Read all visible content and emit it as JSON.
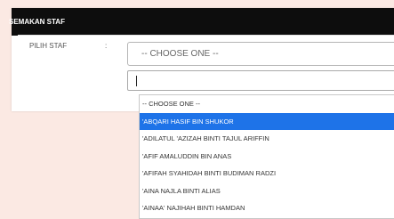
{
  "header": {
    "title": "SEMAKAN STAF"
  },
  "form": {
    "label": "PILIH STAF",
    "colon": ":",
    "select_value": "-- CHOOSE ONE --",
    "search_value": ""
  },
  "dropdown": {
    "options": [
      "-- CHOOSE ONE --",
      "'ABQARI HASIF BIN SHUKOR",
      "'ADILATUL 'AZIZAH BINTI TAJUL ARIFFIN",
      "'AFIF AMALUDDIN BIN ANAS",
      "'AFIFAH SYAHIDAH BINTI BUDIMAN RADZI",
      "'AINA NAJLA BINTI ALIAS",
      "'AINAA' NAJIHAH BINTI HAMDAN"
    ],
    "highlighted_option": "'ABQARI HASIF BIN SHUKOR"
  },
  "colors": {
    "highlight": "#1e73e8",
    "header_bg": "#0d0d0d",
    "page_bg": "#fbe9e3"
  }
}
